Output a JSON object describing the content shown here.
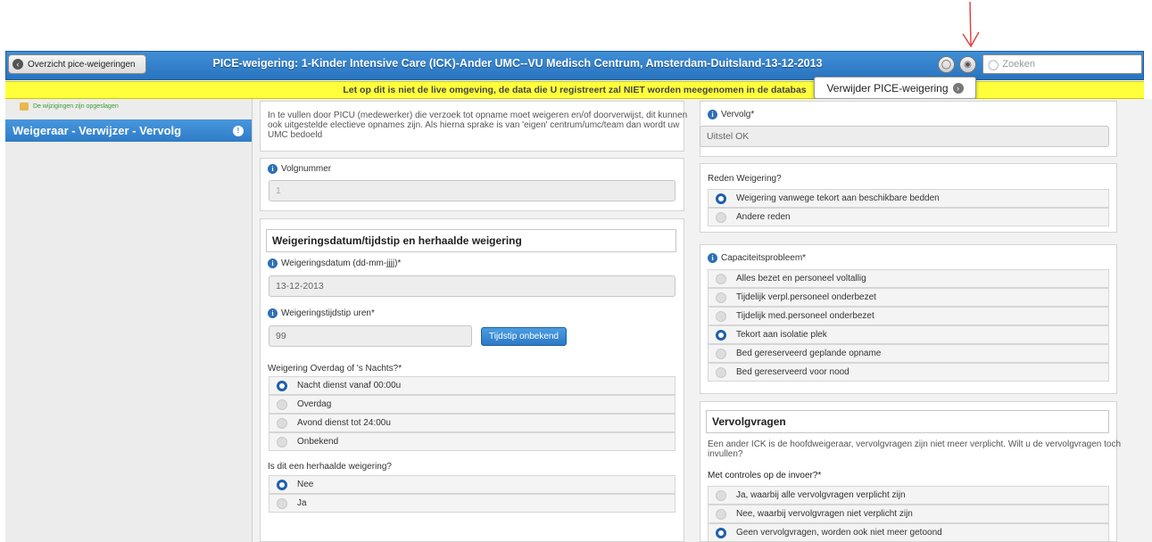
{
  "header": {
    "back_label": "Overzicht pice-weigeringen",
    "title": "PICE-weigering: 1-Kinder Intensive Care (ICK)-Ander UMC--VU Medisch Centrum, Amsterdam-Duitsland-13-12-2013",
    "search_placeholder": "Zoeken",
    "tooltip": "Verwijder PICE-weigering"
  },
  "warning": "Let op dit is niet de live omgeving, de data die U registreert zal NIET worden meegenomen in de databas",
  "sidebar": {
    "saved_note": "De wijzigingen zijn opgeslagen",
    "nav_item": "Weigeraar - Verwijzer - Vervolg"
  },
  "left": {
    "intro": [
      "In te vullen door PICU (medewerker) die verzoek tot opname moet weigeren en/of doorverwijst, dit kunnen",
      "ook uitgestelde electieve opnames zijn. Als hierna sprake is van 'eigen' centrum/umc/team dan wordt uw",
      "UMC bedoeld"
    ],
    "volgnummer_label": "Volgnummer",
    "volgnummer_value": "1",
    "section_title": "Weigeringsdatum/tijdstip en herhaalde weigering",
    "datum_label": "Weigeringsdatum (dd-mm-jjjj)*",
    "datum_value": "13-12-2013",
    "tijd_label": "Weigeringstijdstip uren*",
    "tijd_value": "99",
    "tijd_button": "Tijdstip onbekend",
    "overdag_label": "Weigering Overdag of 's Nachts?*",
    "overdag_options": [
      "Nacht dienst vanaf 00:00u",
      "Overdag",
      "Avond dienst tot 24:00u",
      "Onbekend"
    ],
    "overdag_selected": 0,
    "herhaald_label": "Is dit een herhaalde weigering?",
    "herhaald_options": [
      "Nee",
      "Ja"
    ],
    "herhaald_selected": 0
  },
  "right": {
    "vervolg_label": "Vervolg*",
    "vervolg_value": "Uitstel OK",
    "reden_label": "Reden Weigering?",
    "reden_options": [
      "Weigering vanwege tekort aan beschikbare bedden",
      "Andere reden"
    ],
    "reden_selected": 0,
    "capaciteit_label": "Capaciteitsprobleem*",
    "capaciteit_options": [
      "Alles bezet en personeel voltallig",
      "Tijdelijk verpl.personeel onderbezet",
      "Tijdelijk med.personeel onderbezet",
      "Tekort aan isolatie plek",
      "Bed gereserveerd geplande opname",
      "Bed gereserveerd voor nood"
    ],
    "capaciteit_selected": 3,
    "vervolgvragen_title": "Vervolgvragen",
    "vervolgvragen_text": [
      "Een ander ICK is de hoofdweigeraar, vervolgvragen zijn niet meer verplicht. Wilt u de vervolgvragen toch",
      "invullen?"
    ],
    "controles_label": "Met controles op de invoer?*",
    "controles_options": [
      "Ja, waarbij alle vervolgvragen verplicht zijn",
      "Nee, waarbij vervolgvragen niet verplicht zijn",
      "Geen vervolgvragen, worden ook niet meer getoond"
    ],
    "controles_selected": 2
  },
  "colors": {
    "header_blue": "#2f7cc6",
    "warning_yellow": "#ffff3c",
    "saved_green": "#3a9b2f",
    "radio_blue": "#1f5fad"
  }
}
